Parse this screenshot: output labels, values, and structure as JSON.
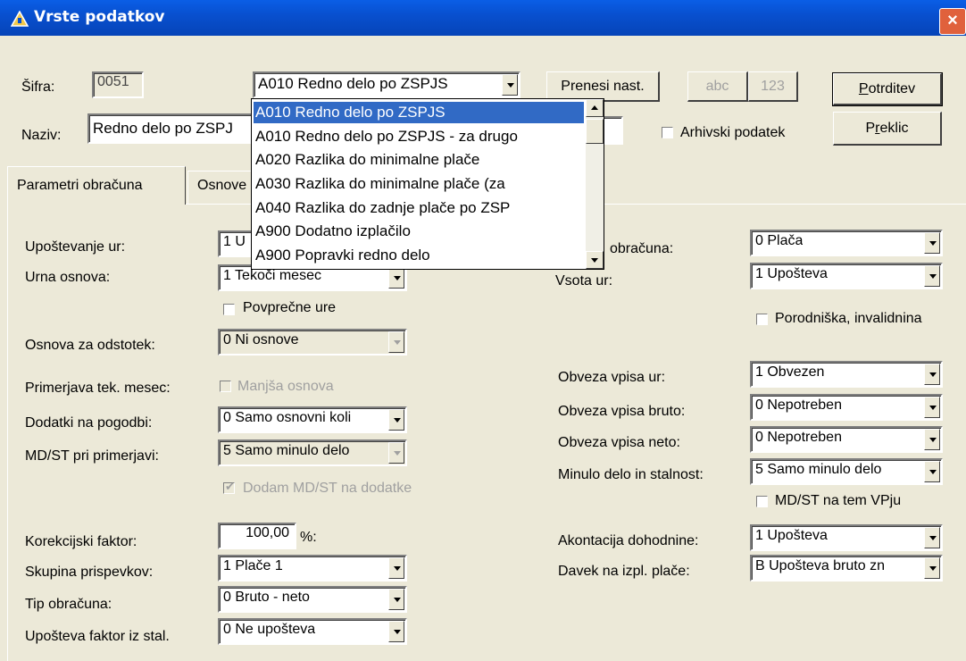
{
  "window": {
    "title": "Vrste podatkov",
    "close_label": "×"
  },
  "header": {
    "sifra_label": "Šifra:",
    "sifra_value": "0051",
    "naziv_label": "Naziv:",
    "naziv_value": "Redno delo po ZSPJ",
    "type_combo_value": "A010 Redno delo po ZSPJS",
    "prenesi_label": "Prenesi nast.",
    "abc_label": "abc",
    "num_label": "123",
    "potrditev_prefix": "P",
    "potrditev_rest": "otrditev",
    "preklic_prefix": "P",
    "preklic_u": "r",
    "preklic_rest": "eklic",
    "arhivski_label": "Arhivski podatek"
  },
  "dropdown": {
    "items": [
      "A010 Redno delo po ZSPJS",
      "A010 Redno delo po ZSPJS - za drugo",
      "A020 Razlika do minimalne plače",
      "A030 Razlika do minimalne plače (za",
      "A040 Razlika do zadnje plače po ZSP",
      "A900 Dodatno izplačilo",
      "A900 Popravki redno delo"
    ]
  },
  "tabs": [
    "Parametri obračuna",
    "Osnove"
  ],
  "left": {
    "upostevanje_ur_label": "Upoštevanje ur:",
    "upostevanje_ur_value": "1 U",
    "urna_osnova_label": "Urna osnova:",
    "urna_osnova_value": "1 Tekoči mesec",
    "povprecne_ure_label": "Povprečne ure",
    "osnova_odstotek_label": "Osnova za odstotek:",
    "osnova_odstotek_value": "0 Ni osnove",
    "primerjava_label": "Primerjava tek. mesec:",
    "manjsa_osnova_label": "Manjša osnova",
    "dodatki_label": "Dodatki na pogodbi:",
    "dodatki_value": "0 Samo osnovni koli",
    "mdst_primerjavi_label": "MD/ST pri primerjavi:",
    "mdst_primerjavi_value": "5 Samo minulo delo",
    "dodam_label": "Dodam MD/ST na dodatke",
    "korekcijski_label": "Korekcijski faktor:",
    "korekcijski_value": "100,00",
    "korekcijski_unit": "%:",
    "skupina_label": "Skupina prispevkov:",
    "skupina_value": "1 Plače 1",
    "tip_label": "Tip obračuna:",
    "tip_value": "0 Bruto - neto",
    "upostevanje_faktor_label": "Upošteva faktor iz stal.",
    "upostevanje_faktor_value": "0 Ne upošteva"
  },
  "right": {
    "obracuna_label": "obračuna:",
    "obracuna_value": "0 Plača",
    "vsota_label": "Vsota ur:",
    "vsota_value": "1 Upošteva",
    "porodniska_label": "Porodniška, invalidnina",
    "obveza_ur_label": "Obveza vpisa ur:",
    "obveza_ur_value": "1 Obvezen",
    "obveza_bruto_label": "Obveza vpisa bruto:",
    "obveza_bruto_value": "0 Nepotreben",
    "obveza_neto_label": "Obveza vpisa neto:",
    "obveza_neto_value": "0 Nepotreben",
    "minulo_label": "Minulo delo in stalnost:",
    "minulo_value": "5 Samo minulo delo",
    "mdst_vp_label": "MD/ST na tem VPju",
    "akontacija_label": "Akontacija dohodnine:",
    "akontacija_value": "1 Upošteva",
    "davek_label": "Davek na izpl. plače:",
    "davek_value": "B Upošteva bruto zn"
  }
}
